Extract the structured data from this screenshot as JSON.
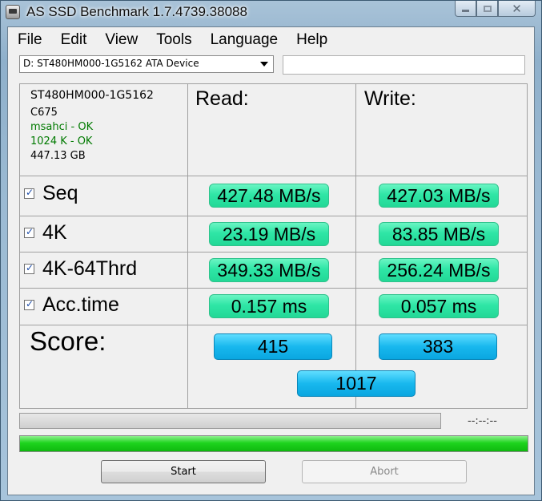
{
  "window": {
    "title": "AS SSD Benchmark 1.7.4739.38088",
    "icons": [
      "app-icon",
      "minimize-icon",
      "maximize-icon",
      "close-icon"
    ]
  },
  "menu": {
    "items": [
      "File",
      "Edit",
      "View",
      "Tools",
      "Language",
      "Help"
    ]
  },
  "drive_select": {
    "value": "D: ST480HM000-1G5162 ATA Device"
  },
  "device_info": {
    "model": "ST480HM000-1G5162",
    "firmware": "C675",
    "driver_status": "msahci - OK",
    "alignment_status": "1024 K - OK",
    "capacity": "447.13 GB"
  },
  "columns": {
    "read": "Read:",
    "write": "Write:"
  },
  "tests": [
    {
      "label": "Seq",
      "checked": true,
      "read": "427.48 MB/s",
      "write": "427.03 MB/s"
    },
    {
      "label": "4K",
      "checked": true,
      "read": "23.19 MB/s",
      "write": "83.85 MB/s"
    },
    {
      "label": "4K-64Thrd",
      "checked": true,
      "read": "349.33 MB/s",
      "write": "256.24 MB/s"
    },
    {
      "label": "Acc.time",
      "checked": true,
      "read": "0.157 ms",
      "write": "0.057 ms"
    }
  ],
  "score": {
    "label": "Score:",
    "read": "415",
    "write": "383",
    "total": "1017"
  },
  "progress": {
    "elapsed_time": "--:--:--",
    "overall_fraction": 1.0
  },
  "buttons": {
    "start": "Start",
    "abort": "Abort"
  },
  "colors": {
    "value_pill": "#2fe6a6",
    "score_pill": "#18b8ee",
    "progress_fill": "#1ed41e",
    "ok_text": "#007a00"
  }
}
